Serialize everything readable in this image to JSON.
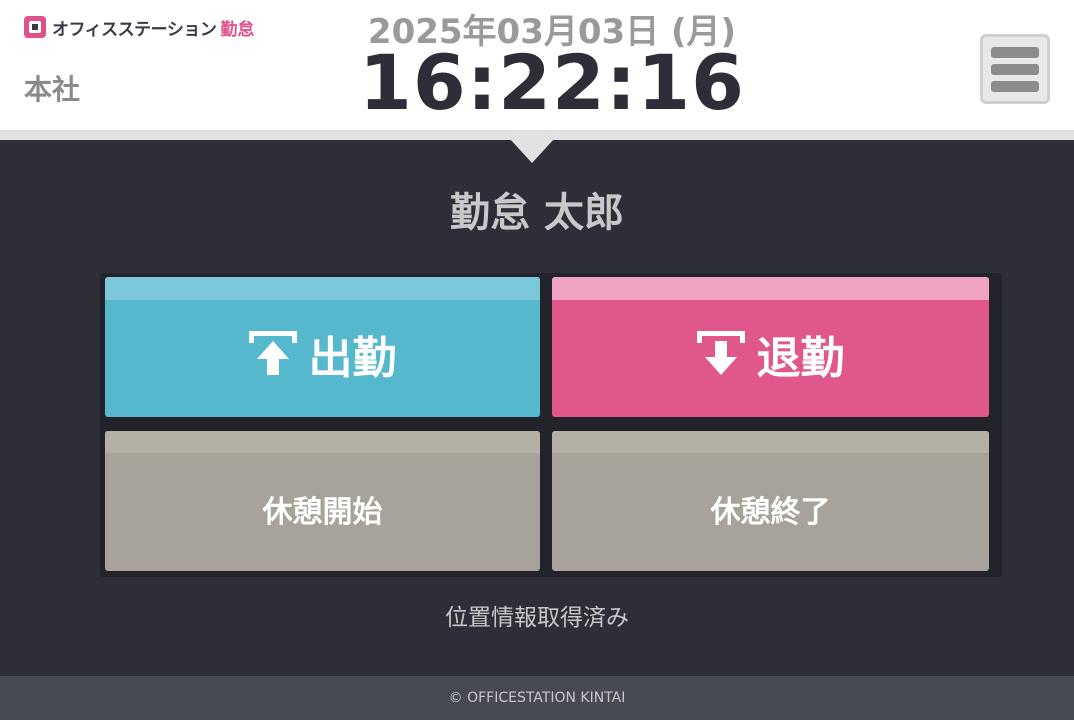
{
  "header": {
    "logo_text": "オフィスステーション",
    "logo_accent": "勤怠",
    "office": "本社",
    "date": "2025年03月03日 (月)",
    "time": "16:22:16"
  },
  "user": {
    "name": "勤怠 太郎"
  },
  "actions": {
    "clock_in": "出勤",
    "clock_out": "退勤",
    "break_start": "休憩開始",
    "break_end": "休憩終了"
  },
  "status": {
    "location": "位置情報取得済み"
  },
  "footer": {
    "copyright": "© OFFICESTATION KINTAI"
  },
  "colors": {
    "accent_pink": "#e0588b",
    "accent_cyan": "#56b8cd",
    "neutral_button": "#a7a39a",
    "background": "#2e2e38"
  },
  "icons": {
    "menu": "hamburger-icon",
    "clock_in": "arrow-up-icon",
    "clock_out": "arrow-down-icon"
  }
}
